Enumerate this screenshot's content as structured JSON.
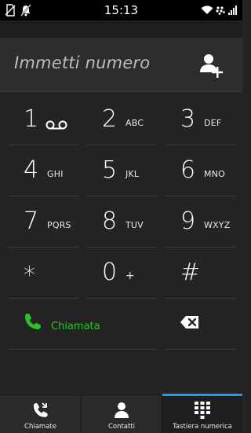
{
  "status_bar": {
    "time": "15:13",
    "icons": [
      "no-sim-icon",
      "notification-bell-muted-icon",
      "wifi-icon",
      "blackberry-icon",
      "signal-icon"
    ]
  },
  "dial_input": {
    "placeholder": "Immetti numero",
    "add_contact_icon": "add-contact-icon"
  },
  "keypad": {
    "keys": [
      {
        "digit": "1",
        "letters": "",
        "icon": "voicemail-icon"
      },
      {
        "digit": "2",
        "letters": "ABC"
      },
      {
        "digit": "3",
        "letters": "DEF"
      },
      {
        "digit": "4",
        "letters": "GHI"
      },
      {
        "digit": "5",
        "letters": "JKL"
      },
      {
        "digit": "6",
        "letters": "MNO"
      },
      {
        "digit": "7",
        "letters": "PQRS"
      },
      {
        "digit": "8",
        "letters": "TUV"
      },
      {
        "digit": "9",
        "letters": "WXYZ"
      },
      {
        "digit": "*",
        "letters": ""
      },
      {
        "digit": "0",
        "letters": "+"
      },
      {
        "digit": "#",
        "letters": ""
      }
    ],
    "call_label": "Chiamata",
    "call_color": "#2fc02f",
    "backspace_icon": "backspace-icon"
  },
  "bottom_nav": {
    "items": [
      {
        "label": "Chiamate",
        "icon": "recent-calls-icon"
      },
      {
        "label": "Contatti",
        "icon": "contacts-icon"
      },
      {
        "label": "Tastiera numerica",
        "icon": "dialpad-icon",
        "active": true
      }
    ],
    "active_color": "#1ea0e6"
  }
}
